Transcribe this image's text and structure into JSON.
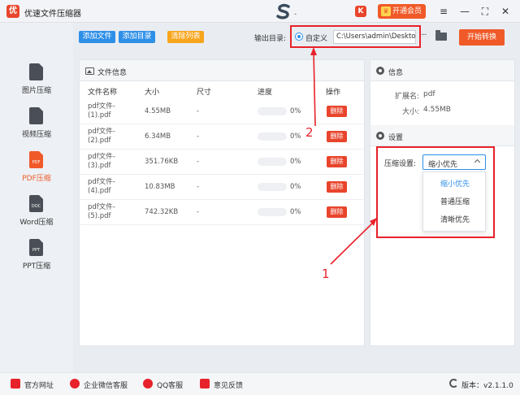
{
  "app": {
    "title": "优速文件压缩器",
    "logo_letter": "优",
    "brand_badge": "K",
    "vip_label": "开通会员",
    "vip_icon": "crown-icon"
  },
  "sidebar": {
    "items": [
      {
        "label": "图片压缩",
        "icon": "image-file-icon",
        "badge": "",
        "active": false
      },
      {
        "label": "视频压缩",
        "icon": "video-file-icon",
        "badge": "",
        "active": false
      },
      {
        "label": "PDF压缩",
        "icon": "pdf-file-icon",
        "badge": "PDF",
        "active": true
      },
      {
        "label": "Word压缩",
        "icon": "doc-file-icon",
        "badge": "DOC",
        "active": false
      },
      {
        "label": "PPT压缩",
        "icon": "ppt-file-icon",
        "badge": "PPT",
        "active": false
      }
    ]
  },
  "toolbar": {
    "add_file": "添加文件",
    "add_dir": "添加目录",
    "clear_list": "清除列表",
    "output_label": "输出目录:",
    "radio_label": "自定义",
    "path_value": "C:\\Users\\admin\\Deskto",
    "more": "···",
    "start": "开始转换"
  },
  "file_panel": {
    "title": "文件信息",
    "columns": [
      "文件名称",
      "大小",
      "尺寸",
      "进度",
      "操作"
    ],
    "rows": [
      {
        "name": "pdf文件-(1).pdf",
        "size": "4.55MB",
        "dim": "-",
        "progress": 0,
        "pct": "0%",
        "action": "删除"
      },
      {
        "name": "pdf文件-(2).pdf",
        "size": "6.34MB",
        "dim": "-",
        "progress": 0,
        "pct": "0%",
        "action": "删除"
      },
      {
        "name": "pdf文件-(3).pdf",
        "size": "351.76KB",
        "dim": "-",
        "progress": 0,
        "pct": "0%",
        "action": "删除"
      },
      {
        "name": "pdf文件-(4).pdf",
        "size": "10.83MB",
        "dim": "-",
        "progress": 0,
        "pct": "0%",
        "action": "删除"
      },
      {
        "name": "pdf文件-(5).pdf",
        "size": "742.32KB",
        "dim": "-",
        "progress": 0,
        "pct": "0%",
        "action": "删除"
      }
    ]
  },
  "info_panel": {
    "title": "信息",
    "ext_label": "扩展名:",
    "ext_value": "pdf",
    "size_label": "大小:",
    "size_value": "4.55MB"
  },
  "settings_panel": {
    "title": "设置",
    "compress_label": "压缩设置:",
    "selected": "缩小优先",
    "options": [
      "缩小优先",
      "普通压缩",
      "清晰优先"
    ]
  },
  "annotations": {
    "one": "1",
    "two": "2",
    "color": "#e8222a"
  },
  "footer": {
    "links": [
      "官方网址",
      "企业微信客服",
      "QQ客服",
      "意见反馈"
    ],
    "version": "版本：v2.1.1.0"
  },
  "colors": {
    "accent": "#f05a28",
    "blue": "#2e8fe8",
    "delete": "#e8452c"
  }
}
